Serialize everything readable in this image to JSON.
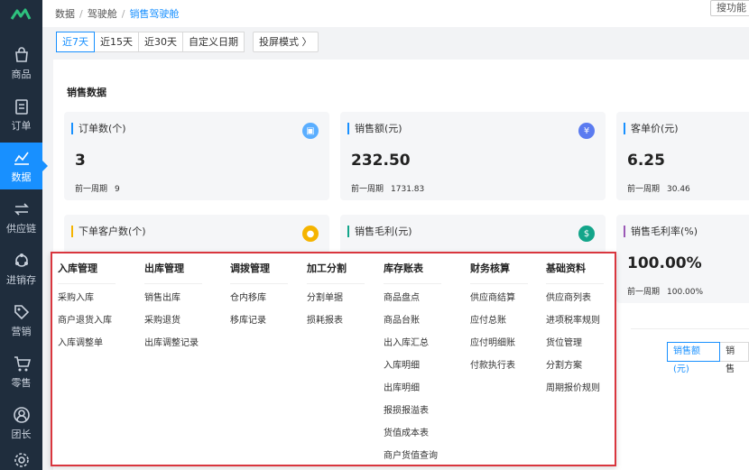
{
  "sidebar": {
    "items": [
      {
        "label": "商品",
        "icon": "shopping-bag-icon"
      },
      {
        "label": "订单",
        "icon": "document-icon"
      },
      {
        "label": "数据",
        "icon": "line-chart-icon"
      },
      {
        "label": "供应链",
        "icon": "exchange-icon"
      },
      {
        "label": "进销存",
        "icon": "cycle-icon"
      },
      {
        "label": "营销",
        "icon": "tag-icon"
      },
      {
        "label": "零售",
        "icon": "cart-icon"
      },
      {
        "label": "团长",
        "icon": "user-icon"
      }
    ],
    "active_index": 2
  },
  "breadcrumb": {
    "items": [
      "数据",
      "驾驶舱",
      "销售驾驶舱"
    ]
  },
  "search_button": "搜功能",
  "filters": {
    "options": [
      "近7天",
      "近15天",
      "近30天",
      "自定义日期"
    ],
    "active": "近7天",
    "screen_mode": "投屏模式 〉"
  },
  "panel": {
    "title": "销售数据",
    "cards": [
      {
        "title": "订单数(个)",
        "value": "3",
        "prev_label": "前一周期",
        "prev_value": "9",
        "icon": "clipboard-icon",
        "icon_color": "#5aaeff"
      },
      {
        "title": "销售额(元)",
        "value": "232.50",
        "prev_label": "前一周期",
        "prev_value": "1731.83",
        "icon": "yen-icon",
        "icon_color": "#5b7bf0"
      },
      {
        "title": "客单价(元)",
        "value": "6.25",
        "prev_label": "前一周期",
        "prev_value": "30.46"
      },
      {
        "title": "下单客户数(个)",
        "icon": "person-icon",
        "icon_color": "#f5b400"
      },
      {
        "title": "销售毛利(元)",
        "icon": "money-bag-icon",
        "icon_color": "#13a58a"
      },
      {
        "title": "销售毛利率(%)",
        "value": "100.00%",
        "prev_label": "前一周期",
        "prev_value": "100.00%"
      }
    ],
    "toggle": [
      "销售额(元)",
      "销售"
    ]
  },
  "menu": {
    "columns": [
      {
        "head": "入库管理",
        "items": [
          "采购入库",
          "商户退货入库",
          "入库调整单"
        ]
      },
      {
        "head": "出库管理",
        "items": [
          "销售出库",
          "采购退货",
          "出库调整记录"
        ]
      },
      {
        "head": "调拨管理",
        "items": [
          "仓内移库",
          "移库记录"
        ]
      },
      {
        "head": "加工分割",
        "items": [
          "分割单据",
          "损耗报表"
        ]
      },
      {
        "head": "库存账表",
        "items": [
          "商品盘点",
          "商品台账",
          "出入库汇总",
          "入库明细",
          "出库明细",
          "报损报溢表",
          "货值成本表",
          "商户货值查询"
        ]
      },
      {
        "head": "财务核算",
        "items": [
          "供应商结算",
          "应付总账",
          "应付明细账",
          "付款执行表"
        ]
      },
      {
        "head": "基础资料",
        "items": [
          "供应商列表",
          "进项税率规则",
          "货位管理",
          "分割方案",
          "周期报价规则"
        ]
      }
    ]
  },
  "colors": {
    "accent": "#1890ff",
    "sidebar_bg": "#1f2d3d",
    "highlight_border": "#d9363e"
  }
}
